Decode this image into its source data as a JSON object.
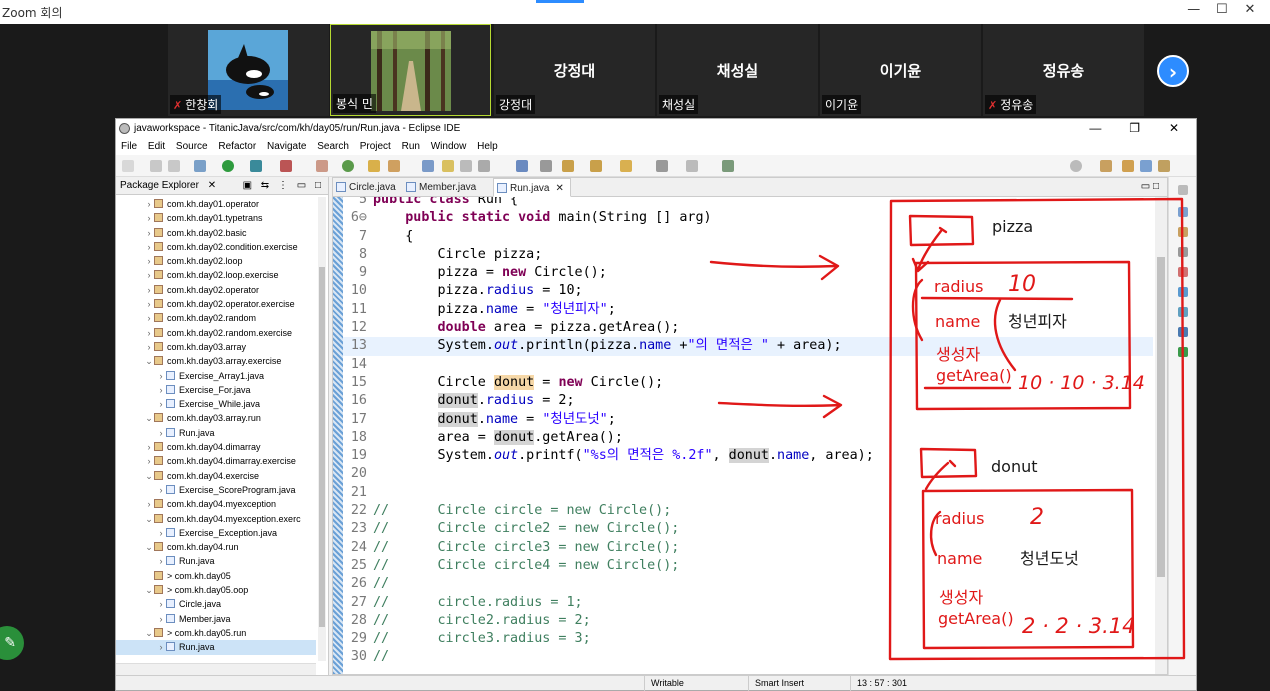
{
  "zoom": {
    "window_title": "Zoom 회의",
    "controls": [
      "—",
      "☐",
      "✕"
    ],
    "participants": [
      {
        "name": "한창회",
        "label": "한창회",
        "muted": true,
        "video": "orca"
      },
      {
        "name": "봉식 민",
        "label": "봉식 민",
        "muted": false,
        "video": "forest"
      },
      {
        "name": "강정대",
        "label": "강정대",
        "muted": false
      },
      {
        "name": "채성실",
        "label": "채성실",
        "muted": false
      },
      {
        "name": "이기윤",
        "label": "이기윤",
        "muted": false
      },
      {
        "name": "정유송",
        "label": "정유송",
        "muted": true
      }
    ],
    "next_icon": "›",
    "mute_icon": "✗"
  },
  "eclipse": {
    "title": "javaworkspace - TitanicJava/src/com/kh/day05/run/Run.java - Eclipse IDE",
    "window_controls": [
      "—",
      "❐",
      "✕"
    ],
    "menu": [
      "File",
      "Edit",
      "Source",
      "Refactor",
      "Navigate",
      "Search",
      "Project",
      "Run",
      "Window",
      "Help"
    ],
    "package_explorer": {
      "title": "Package Explorer",
      "close": "✕",
      "items": [
        {
          "arrow": "›",
          "text": "com.kh.day01.operator",
          "indent": 2,
          "type": "pkg"
        },
        {
          "arrow": "›",
          "text": "com.kh.day01.typetrans",
          "indent": 2,
          "type": "pkg"
        },
        {
          "arrow": "›",
          "text": "com.kh.day02.basic",
          "indent": 2,
          "type": "pkg"
        },
        {
          "arrow": "›",
          "text": "com.kh.day02.condition.exercise",
          "indent": 2,
          "type": "pkg"
        },
        {
          "arrow": "›",
          "text": "com.kh.day02.loop",
          "indent": 2,
          "type": "pkg"
        },
        {
          "arrow": "›",
          "text": "com.kh.day02.loop.exercise",
          "indent": 2,
          "type": "pkg"
        },
        {
          "arrow": "›",
          "text": "com.kh.day02.operator",
          "indent": 2,
          "type": "pkg"
        },
        {
          "arrow": "›",
          "text": "com.kh.day02.operator.exercise",
          "indent": 2,
          "type": "pkg"
        },
        {
          "arrow": "›",
          "text": "com.kh.day02.random",
          "indent": 2,
          "type": "pkg"
        },
        {
          "arrow": "›",
          "text": "com.kh.day02.random.exercise",
          "indent": 2,
          "type": "pkg"
        },
        {
          "arrow": "›",
          "text": "com.kh.day03.array",
          "indent": 2,
          "type": "pkg"
        },
        {
          "arrow": "⌄",
          "text": "com.kh.day03.array.exercise",
          "indent": 2,
          "type": "pkg"
        },
        {
          "arrow": "›",
          "text": "Exercise_Array1.java",
          "indent": 3,
          "type": "java"
        },
        {
          "arrow": "›",
          "text": "Exercise_For.java",
          "indent": 3,
          "type": "java"
        },
        {
          "arrow": "›",
          "text": "Exercise_While.java",
          "indent": 3,
          "type": "java"
        },
        {
          "arrow": "⌄",
          "text": "com.kh.day03.array.run",
          "indent": 2,
          "type": "pkg"
        },
        {
          "arrow": "›",
          "text": "Run.java",
          "indent": 3,
          "type": "java"
        },
        {
          "arrow": "›",
          "text": "com.kh.day04.dimarray",
          "indent": 2,
          "type": "pkg"
        },
        {
          "arrow": "›",
          "text": "com.kh.day04.dimarray.exercise",
          "indent": 2,
          "type": "pkg"
        },
        {
          "arrow": "⌄",
          "text": "com.kh.day04.exercise",
          "indent": 2,
          "type": "pkg"
        },
        {
          "arrow": "›",
          "text": "Exercise_ScoreProgram.java",
          "indent": 3,
          "type": "java"
        },
        {
          "arrow": "›",
          "text": "com.kh.day04.myexception",
          "indent": 2,
          "type": "pkg"
        },
        {
          "arrow": "⌄",
          "text": "com.kh.day04.myexception.exerc",
          "indent": 2,
          "type": "pkg"
        },
        {
          "arrow": "›",
          "text": "Exercise_Exception.java",
          "indent": 3,
          "type": "java"
        },
        {
          "arrow": "⌄",
          "text": "com.kh.day04.run",
          "indent": 2,
          "type": "pkg"
        },
        {
          "arrow": "›",
          "text": "Run.java",
          "indent": 3,
          "type": "java"
        },
        {
          "arrow": "",
          "text": "> com.kh.day05",
          "indent": 2,
          "type": "pkg"
        },
        {
          "arrow": "⌄",
          "text": "> com.kh.day05.oop",
          "indent": 2,
          "type": "pkg"
        },
        {
          "arrow": "›",
          "text": "Circle.java",
          "indent": 3,
          "type": "java"
        },
        {
          "arrow": "›",
          "text": "Member.java",
          "indent": 3,
          "type": "java"
        },
        {
          "arrow": "⌄",
          "text": "> com.kh.day05.run",
          "indent": 2,
          "type": "pkg"
        },
        {
          "arrow": "›",
          "text": "Run.java",
          "indent": 3,
          "type": "java",
          "selected": true
        }
      ]
    },
    "tabs": [
      {
        "label": "Circle.java",
        "active": false
      },
      {
        "label": "Member.java",
        "active": false
      },
      {
        "label": "Run.java",
        "active": true,
        "close": "✕"
      }
    ],
    "code": [
      {
        "no": "5",
        "html": "<span class=\"kw\">public class</span> Run {"
      },
      {
        "no": "6⊖",
        "html": "    <span class=\"kw\">public static void</span> main(String [] arg)"
      },
      {
        "no": "7",
        "html": "    {"
      },
      {
        "no": "8",
        "html": "        Circle pizza;"
      },
      {
        "no": "9",
        "html": "        pizza = <span class=\"kw\">new</span> Circle();"
      },
      {
        "no": "10",
        "html": "        pizza.<span class=\"fld\">radius</span> = 10;"
      },
      {
        "no": "11",
        "html": "        pizza.<span class=\"fld\">name</span> = <span class=\"st\">\"청년피자\"</span>;"
      },
      {
        "no": "12",
        "html": "        <span class=\"kw\">double</span> area = pizza.getArea();"
      },
      {
        "no": "13",
        "html": "        System.<span class=\"sfld\">out</span>.println(pizza.<span class=\"fld\">name</span> +<span class=\"st\">\"의 면적은 \"</span> + area);",
        "hl": true
      },
      {
        "no": "14",
        "html": ""
      },
      {
        "no": "15",
        "html": "        Circle <span class=\"occw\">donut</span> = <span class=\"kw\">new</span> Circle();"
      },
      {
        "no": "16",
        "html": "        <span class=\"occ\">donut</span>.<span class=\"fld\">radius</span> = 2;"
      },
      {
        "no": "17",
        "html": "        <span class=\"occ\">donut</span>.<span class=\"fld\">name</span> = <span class=\"st\">\"청년도넛\"</span>;"
      },
      {
        "no": "18",
        "html": "        area = <span class=\"occ\">donut</span>.getArea();"
      },
      {
        "no": "19",
        "html": "        System.<span class=\"sfld\">out</span>.printf(<span class=\"st\">\"%s의 면적은 %.2f\"</span>, <span class=\"occ\">donut</span>.<span class=\"fld\">name</span>, area);"
      },
      {
        "no": "20",
        "html": ""
      },
      {
        "no": "21",
        "html": ""
      },
      {
        "no": "22",
        "html": "<span class=\"cm\">//      Circle circle = new Circle();</span>"
      },
      {
        "no": "23",
        "html": "<span class=\"cm\">//      Circle circle2 = new Circle();</span>"
      },
      {
        "no": "24",
        "html": "<span class=\"cm\">//      Circle circle3 = new Circle();</span>"
      },
      {
        "no": "25",
        "html": "<span class=\"cm\">//      Circle circle4 = new Circle();</span>"
      },
      {
        "no": "26",
        "html": "<span class=\"cm\">//</span>"
      },
      {
        "no": "27",
        "html": "<span class=\"cm\">//      circle.radius = 1;</span>"
      },
      {
        "no": "28",
        "html": "<span class=\"cm\">//      circle2.radius = 2;</span>"
      },
      {
        "no": "29",
        "html": "<span class=\"cm\">//      circle3.radius = 3;</span>"
      },
      {
        "no": "30",
        "html": "<span class=\"cm\">//</span>"
      }
    ],
    "status": {
      "writable": "Writable",
      "insert": "Smart Insert",
      "position": "13 : 57 : 301"
    }
  },
  "annotations": {
    "pizza_label": "pizza",
    "pizza_radius_label": "radius",
    "pizza_radius_value": "10",
    "pizza_name_label": "name",
    "pizza_name_value": "청년피자",
    "pizza_ctor": "생성자",
    "pizza_getarea": "getArea()",
    "pizza_formula": "10 · 10 · 3.14",
    "donut_label": "donut",
    "donut_radius_label": "radius",
    "donut_radius_value": "2",
    "donut_name_label": "name",
    "donut_name_value": "청년도넛",
    "donut_ctor": "생성자",
    "donut_getarea": "getArea()",
    "donut_formula": "2 · 2 · 3.14",
    "ink_color": "#e01818"
  }
}
